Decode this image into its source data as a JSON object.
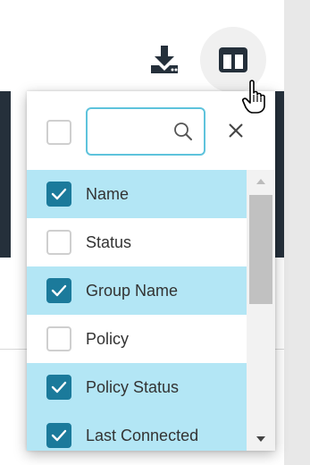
{
  "toolbar": {
    "download_icon": "download-icon",
    "columns_icon": "columns-icon",
    "cursor_icon": "hand-pointer-icon"
  },
  "column_picker": {
    "search": {
      "value": "",
      "placeholder": ""
    },
    "select_all_checked": false,
    "clear_icon": "close-icon",
    "items": [
      {
        "label": "Name",
        "checked": true
      },
      {
        "label": "Status",
        "checked": false
      },
      {
        "label": "Group Name",
        "checked": true
      },
      {
        "label": "Policy",
        "checked": false
      },
      {
        "label": "Policy Status",
        "checked": true
      },
      {
        "label": "Last Connected",
        "checked": true
      }
    ]
  },
  "colors": {
    "accent": "#1b7a9b",
    "selected_row": "#b3e6f5",
    "search_border": "#5ec3dc",
    "dark_band": "#25303b"
  }
}
